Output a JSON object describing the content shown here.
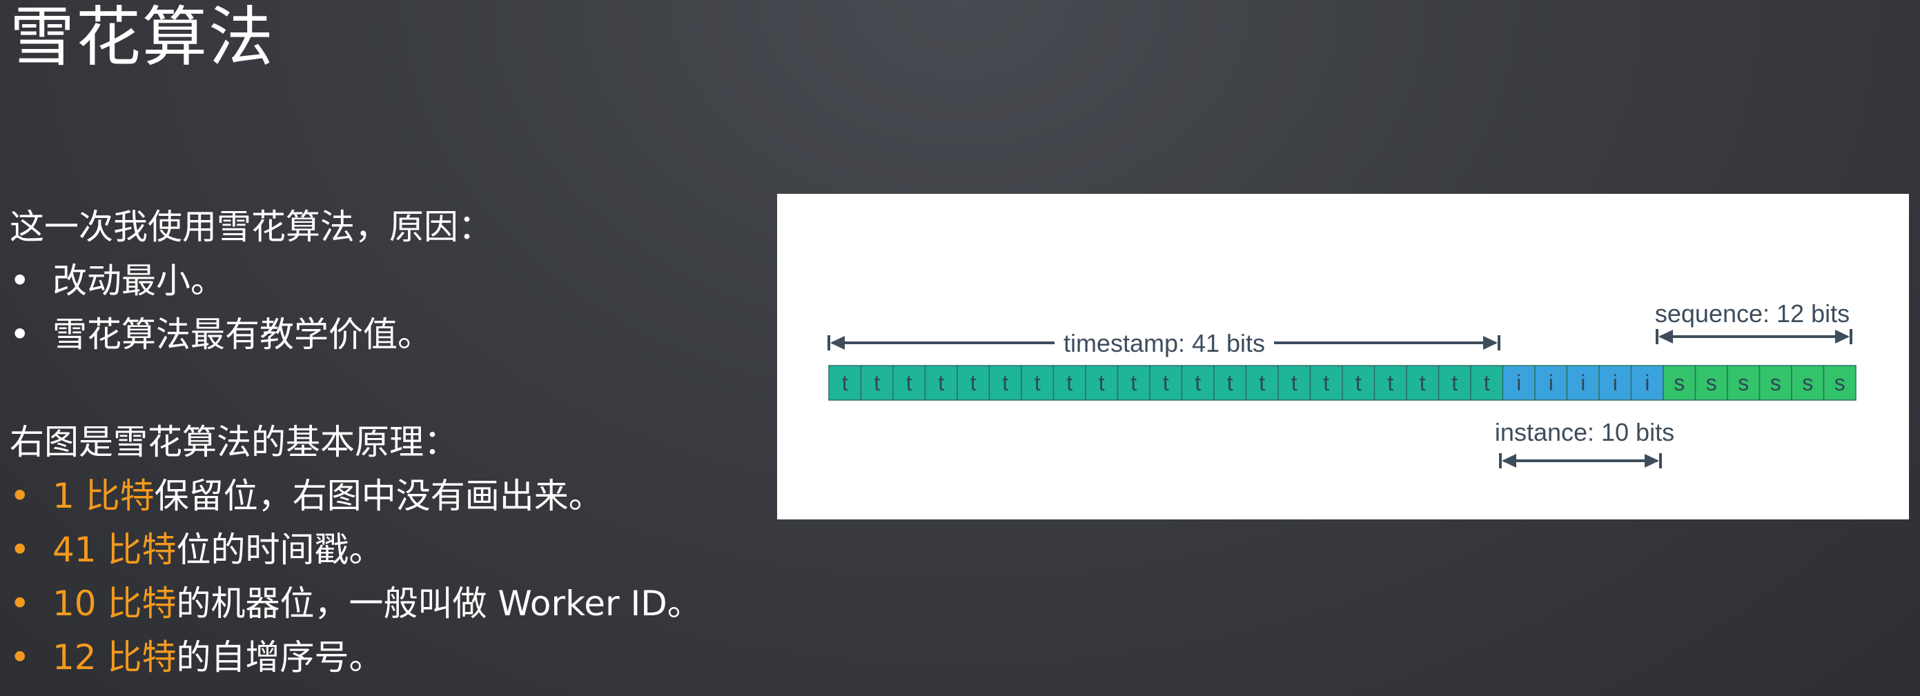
{
  "slide": {
    "title": "雪花算法"
  },
  "reasons": {
    "intro": "这一次我使用雪花算法，原因：",
    "items": [
      "改动最小。",
      "雪花算法最有教学价值。"
    ],
    "bullet": "•"
  },
  "principle": {
    "intro": "右图是雪花算法的基本原理：",
    "bullet": "•",
    "items": [
      {
        "highlight": "1 比特",
        "rest": "保留位，右图中没有画出来。"
      },
      {
        "highlight": "41 比特",
        "rest": "位的时间戳。"
      },
      {
        "highlight": "10 比特",
        "rest": "的机器位，一般叫做 Worker ID。"
      },
      {
        "highlight": "12 比特",
        "rest": "的自增序号。"
      }
    ]
  },
  "diagram": {
    "segments": [
      {
        "name": "timestamp",
        "label": "timestamp: 41 bits",
        "letter": "t",
        "count": 21,
        "color": "#1fb59a"
      },
      {
        "name": "instance",
        "label": "instance: 10 bits",
        "letter": "i",
        "count": 5,
        "color": "#3aa3dd"
      },
      {
        "name": "sequence",
        "label": "sequence: 12 bits",
        "letter": "s",
        "count": 6,
        "color": "#33c36a"
      }
    ],
    "colors": {
      "accent": "#f39a1e",
      "arrow": "#3d4d5c",
      "cell_text": "#2d4a55",
      "cell_border": "#2e6f64"
    }
  }
}
